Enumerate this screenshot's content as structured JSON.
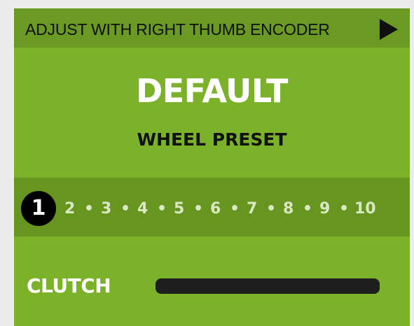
{
  "header": {
    "instruction": "ADJUST WITH RIGHT THUMB ENCODER",
    "arrow_icon": "play-arrow-icon"
  },
  "preset": {
    "name": "DEFAULT",
    "subtitle": "WHEEL PRESET"
  },
  "selector": {
    "active": "1",
    "items": [
      "2",
      "3",
      "4",
      "5",
      "6",
      "7",
      "8",
      "9",
      "10"
    ],
    "separator": "•"
  },
  "clutch": {
    "label": "CLUTCH",
    "value_fraction": 0
  },
  "colors": {
    "background_green": "#7bb229",
    "bar_green": "#6a9a24",
    "strip_green": "#669520",
    "active_circle": "#000000",
    "clutch_track": "#1e1e1e"
  }
}
